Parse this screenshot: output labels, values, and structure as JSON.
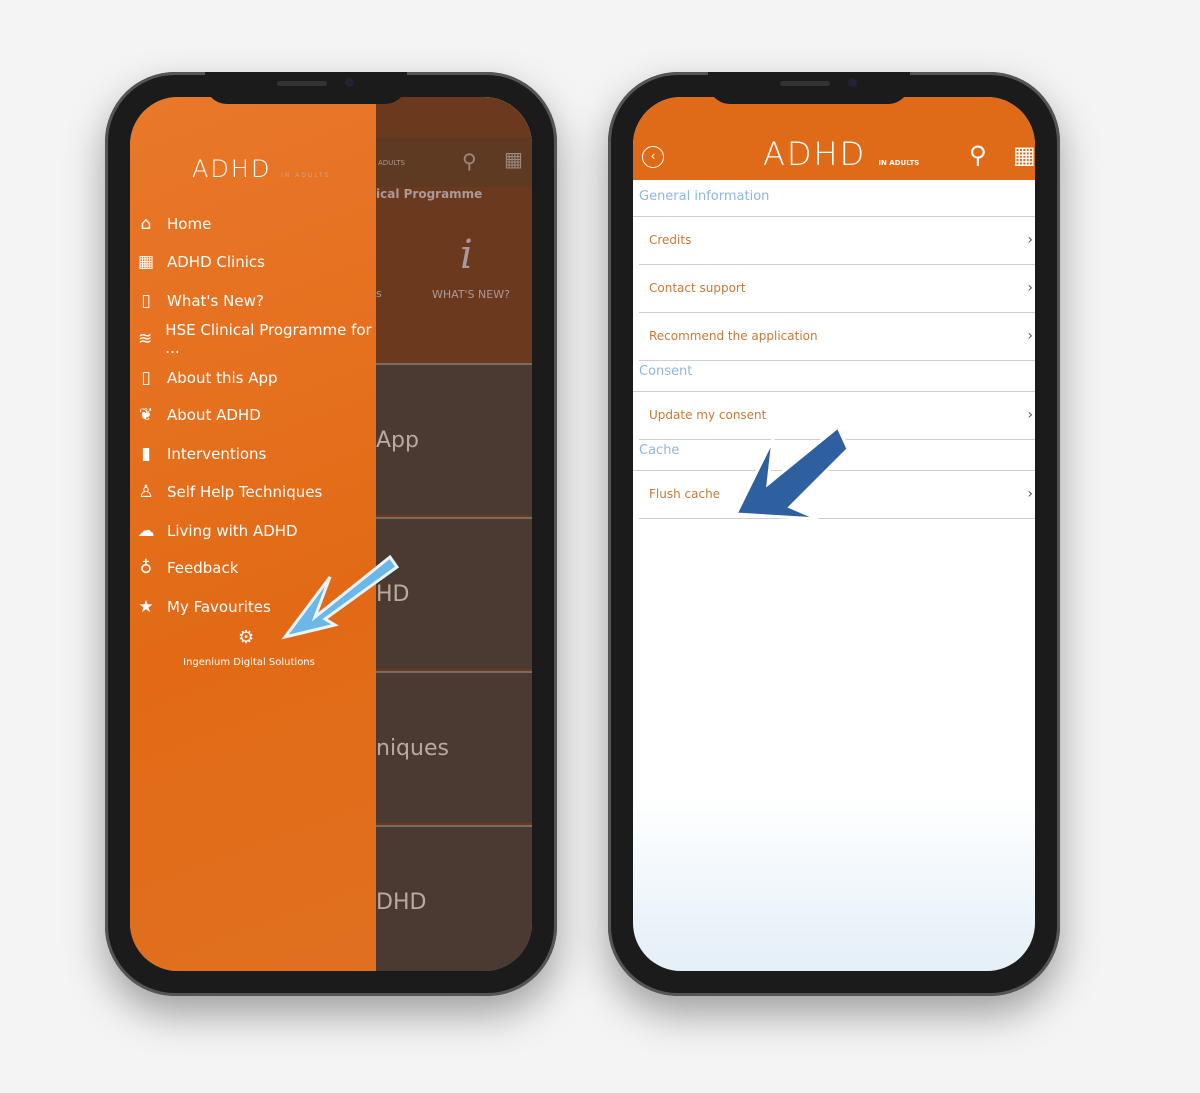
{
  "left_phone": {
    "logo": {
      "title": "ADHD",
      "subtitle": "IN ADULTS"
    },
    "menu": [
      {
        "label": "Home",
        "icon": "home-icon",
        "glyph": "⌂"
      },
      {
        "label": "ADHD Clinics",
        "icon": "clinic-icon",
        "glyph": "▦"
      },
      {
        "label": "What's New?",
        "icon": "phone-icon",
        "glyph": "▯"
      },
      {
        "label": "HSE Clinical Programme for ...",
        "icon": "waves-icon",
        "glyph": "≋"
      },
      {
        "label": "About this App",
        "icon": "phone-icon",
        "glyph": "▯"
      },
      {
        "label": "About ADHD",
        "icon": "leaf-icon",
        "glyph": "❦"
      },
      {
        "label": "Interventions",
        "icon": "bar-chart-icon",
        "glyph": "▮"
      },
      {
        "label": "Self Help Techniques",
        "icon": "meditation-icon",
        "glyph": "♙"
      },
      {
        "label": "Living with ADHD",
        "icon": "weather-icon",
        "glyph": "☁"
      },
      {
        "label": "Feedback",
        "icon": "lightbulb-icon",
        "glyph": "♁"
      },
      {
        "label": "My Favourites",
        "icon": "star-icon",
        "glyph": "★"
      }
    ],
    "footer": {
      "label": "Ingenium Digital Solutions",
      "icon": "gear-icon"
    },
    "background": {
      "header_text": "ical Programme",
      "adults": "ADULTS",
      "tile_label": "WHAT'S NEW?",
      "tile_fragment": "s",
      "tiles": [
        "App",
        "HD",
        "niques",
        "DHD"
      ]
    }
  },
  "right_phone": {
    "logo": {
      "title": "ADHD",
      "subtitle": "IN ADULTS"
    },
    "sections": [
      {
        "title": "General information",
        "items": [
          "Credits",
          "Contact support",
          "Recommend the application"
        ]
      },
      {
        "title": "Consent",
        "items": [
          "Update my consent"
        ]
      },
      {
        "title": "Cache",
        "items": [
          "Flush cache"
        ]
      }
    ]
  },
  "colors": {
    "orange": "#df6a18",
    "section_blue": "#8fb6dc",
    "item_text": "#c57a3a",
    "arrow_light": "#6cb6e8",
    "arrow_dark": "#2e5f9e"
  }
}
